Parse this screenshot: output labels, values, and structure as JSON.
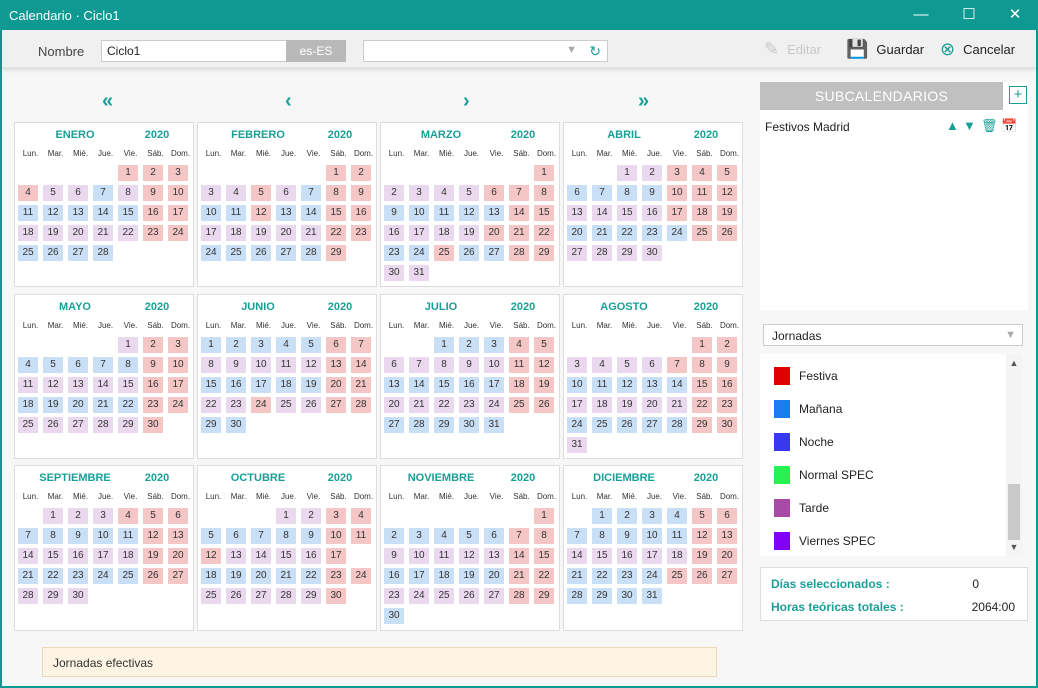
{
  "window": {
    "title": "Calendario · Ciclo1"
  },
  "toolbar": {
    "nombre_label": "Nombre",
    "nombre_value": "Ciclo1",
    "lang": "es-ES",
    "combo_value": "",
    "editar": "Editar",
    "guardar": "Guardar",
    "cancelar": "Cancelar"
  },
  "weekdays": [
    "Lun.",
    "Mar.",
    "Mié.",
    "Jue.",
    "Vie.",
    "Sáb.",
    "Dom."
  ],
  "year": "2020",
  "months": [
    {
      "name": "ENERO",
      "start": 2,
      "rows": [
        "0000rrr",
        "rppbprr",
        "bbbbbrr",
        "ppppprr",
        "bbbb"
      ]
    },
    {
      "name": "FEBRERO",
      "start": 5,
      "rows": [
        "00000rr",
        "pprpbrr",
        "bbrbbrr",
        "ppppprr",
        "bbbbbr"
      ]
    },
    {
      "name": "MARZO",
      "start": 6,
      "rows": [
        "000000r",
        "pppprrr",
        "bbbbbrr",
        "pppprrr",
        "bbrbbrr",
        "pp"
      ]
    },
    {
      "name": "ABRIL",
      "start": 2,
      "rows": [
        "00pprrr",
        "bbbbrrr",
        "pppprrr",
        "bbbbbrr",
        "ppppp"
      ]
    },
    {
      "name": "MAYO",
      "start": 4,
      "rows": [
        "0000prr",
        "bbbbbrr",
        "ppppprr",
        "bbbbbrr",
        "pppppr"
      ]
    },
    {
      "name": "JUNIO",
      "start": 0,
      "rows": [
        "bbbbbrr",
        "ppppprr",
        "bbbbbrr",
        "pprpprr",
        "bb"
      ]
    },
    {
      "name": "JULIO",
      "start": 2,
      "rows": [
        "00bbbrr",
        "ppppprr",
        "bbbbbrr",
        "ppppprr",
        "bbbbb"
      ]
    },
    {
      "name": "AGOSTO",
      "start": 5,
      "rows": [
        "00000rr",
        "pppprrr",
        "bbbbbrr",
        "ppppprr",
        "bbbbbrr",
        "p"
      ]
    },
    {
      "name": "SEPTIEMBRE",
      "start": 1,
      "rows": [
        "0ppprrr",
        "bbbbbrr",
        "ppppprr",
        "bbbbbrr",
        "ppp"
      ]
    },
    {
      "name": "OCTUBRE",
      "start": 3,
      "rows": [
        "000pprr",
        "bbbbbrr",
        "rppppr",
        "bbbbbrr",
        "pppppr"
      ]
    },
    {
      "name": "NOVIEMBRE",
      "start": 6,
      "rows": [
        "000000r",
        "bbbbbrr",
        "ppppprr",
        "bbbbbrr",
        "ppppprr",
        "b"
      ]
    },
    {
      "name": "DICIEMBRE",
      "start": 1,
      "rows": [
        "0bbbbrr",
        "bbbbbrr",
        "ppppprr",
        "bbbbrrr",
        "bbbb"
      ]
    }
  ],
  "month_lengths": [
    31,
    29,
    31,
    30,
    31,
    30,
    31,
    31,
    30,
    31,
    30,
    31
  ],
  "nav": {
    "first": "«",
    "prev": "‹",
    "next": "›",
    "last": "»"
  },
  "footer_note": "Jornadas efectivas",
  "subcalendarios": {
    "title": "SUBCALENDARIOS",
    "add": "+",
    "items": [
      {
        "name": "Festivos Madrid"
      }
    ]
  },
  "jornadas": {
    "selected": "Jornadas",
    "items": [
      {
        "label": "Festiva",
        "color": "#e00000"
      },
      {
        "label": "Mañana",
        "color": "#1a7cf0"
      },
      {
        "label": "Noche",
        "color": "#3838f0"
      },
      {
        "label": "Normal SPEC",
        "color": "#28f050"
      },
      {
        "label": "Tarde",
        "color": "#a84aa8"
      },
      {
        "label": "Viernes SPEC",
        "color": "#8000f8"
      }
    ]
  },
  "stats": {
    "dias_label": "Días seleccionados :",
    "dias_value": "0",
    "horas_label": "Horas teóricas totales :",
    "horas_value": "2064:00"
  },
  "colors": {
    "accent": "#1a9f97",
    "festivo": "#f4c6c6",
    "laborable_a": "#c9dff6",
    "laborable_b": "#ead8ee"
  }
}
